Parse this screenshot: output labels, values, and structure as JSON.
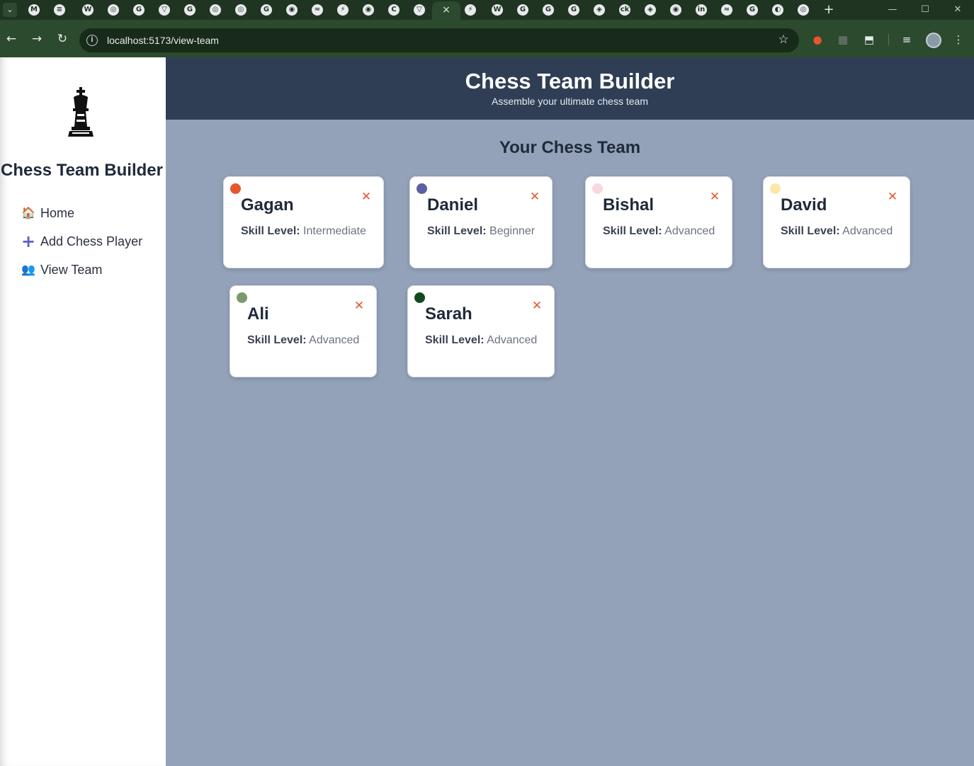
{
  "browser": {
    "url": "localhost:5173/view-team",
    "tab_favicons": [
      "M",
      "≡",
      "W",
      "◎",
      "G",
      "▽",
      "G",
      "◎",
      "◎",
      "G",
      "◉",
      "≈",
      "⚡",
      "◉",
      "C",
      "▽",
      "⚡",
      "W",
      "G",
      "G",
      "G",
      "◈",
      "ck",
      "◈",
      "◉",
      "in",
      "≈",
      "G",
      "◐",
      "◎"
    ],
    "active_tab_close": "×",
    "new_tab": "+",
    "window_controls": {
      "minimize": "—",
      "maximize": "☐",
      "close": "✕"
    },
    "nav": {
      "back": "←",
      "forward": "→",
      "reload": "↻"
    },
    "omnibox_info": "i",
    "bookmark_star": "☆",
    "extensions": [
      "●",
      "▦",
      "⬒",
      "≡"
    ]
  },
  "sidebar": {
    "title": "Chess Team Builder",
    "logo_icon": "chess-king-icon",
    "items": [
      {
        "label": "Home",
        "icon": "🏠"
      },
      {
        "label": "Add Chess Player",
        "icon": "+"
      },
      {
        "label": "View Team",
        "icon": "👥"
      }
    ]
  },
  "header": {
    "title": "Chess Team Builder",
    "subtitle": "Assemble your ultimate chess team"
  },
  "team": {
    "title": "Your Chess Team",
    "skill_key": "Skill Level:",
    "remove_icon": "✕",
    "players": [
      {
        "name": "Gagan",
        "skill": "Intermediate",
        "color": "#e4572e"
      },
      {
        "name": "Daniel",
        "skill": "Beginner",
        "color": "#5b5fa3"
      },
      {
        "name": "Bishal",
        "skill": "Advanced",
        "color": "#f8d7e3"
      },
      {
        "name": "David",
        "skill": "Advanced",
        "color": "#fce8a6"
      },
      {
        "name": "Ali",
        "skill": "Advanced",
        "color": "#7a9a6e"
      },
      {
        "name": "Sarah",
        "skill": "Advanced",
        "color": "#0e4a1c"
      }
    ]
  }
}
